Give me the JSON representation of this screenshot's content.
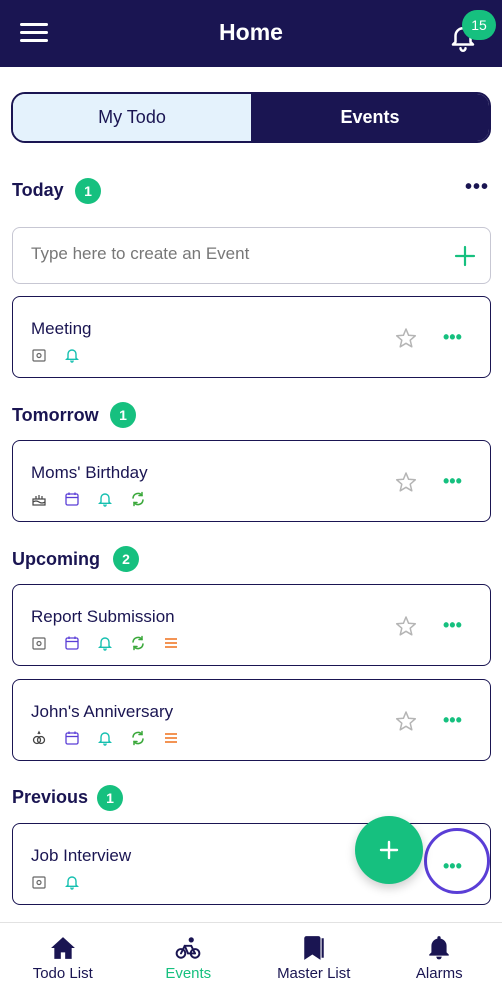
{
  "header": {
    "title": "Home",
    "notification_count": "15"
  },
  "tabs": [
    {
      "label": "My Todo",
      "active": false
    },
    {
      "label": "Events",
      "active": true
    }
  ],
  "sections": {
    "today": {
      "label": "Today",
      "count": "1"
    },
    "tomorrow": {
      "label": "Tomorrow",
      "count": "1"
    },
    "upcoming": {
      "label": "Upcoming",
      "count": "2"
    },
    "previous": {
      "label": "Previous",
      "count": "1"
    }
  },
  "create": {
    "placeholder": "Type here to create an Event"
  },
  "events": {
    "meeting": {
      "title": "Meeting",
      "icons": [
        "meeting-icon",
        "bell-icon"
      ]
    },
    "moms_birthday": {
      "title": "Moms' Birthday",
      "icons": [
        "cake-icon",
        "calendar-icon",
        "bell-icon",
        "repeat-icon"
      ]
    },
    "report_submission": {
      "title": "Report Submission",
      "icons": [
        "meeting-icon",
        "calendar-icon",
        "bell-icon",
        "repeat-icon",
        "list-icon"
      ]
    },
    "johns_anniversary": {
      "title": "John's Anniversary",
      "icons": [
        "rings-icon",
        "calendar-icon",
        "bell-icon",
        "repeat-icon",
        "list-icon"
      ]
    },
    "job_interview": {
      "title": "Job Interview",
      "icons": [
        "meeting-icon",
        "bell-icon"
      ]
    }
  },
  "bottom_nav": [
    {
      "label": "Todo List",
      "icon": "home-icon",
      "active": false
    },
    {
      "label": "Events",
      "icon": "bicycle-icon",
      "active": true
    },
    {
      "label": "Master List",
      "icon": "bookmark-icon",
      "active": false
    },
    {
      "label": "Alarms",
      "icon": "bell-icon",
      "active": false
    }
  ],
  "colors": {
    "primary": "#1a1552",
    "accent": "#16c07f",
    "tab_inactive_bg": "#e4f2fc",
    "highlight_ring": "#5a3ed6"
  }
}
